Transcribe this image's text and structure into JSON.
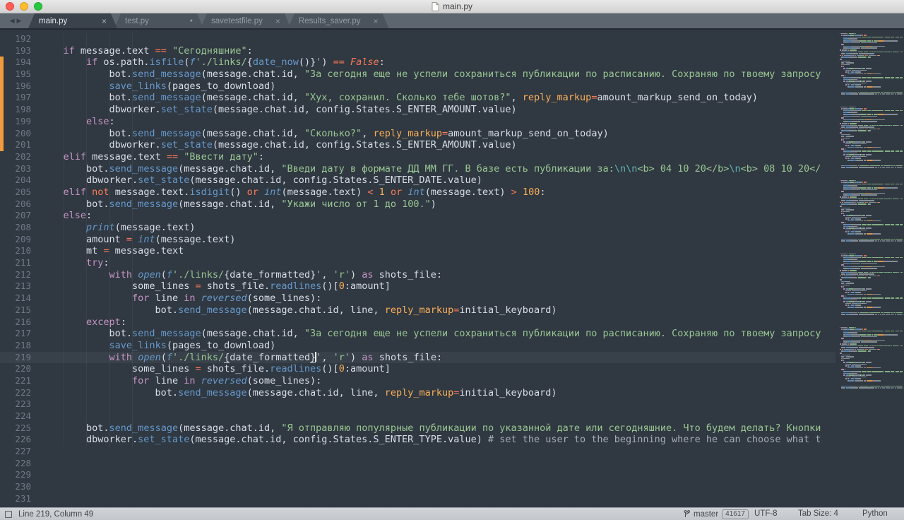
{
  "window": {
    "title": "main.py"
  },
  "tab_bar": {
    "scroll_left": "◀",
    "scroll_right": "▶",
    "close_glyph": "×",
    "dot_glyph": "●",
    "tabs": [
      {
        "label": "main.py",
        "active": true,
        "indicator": "close"
      },
      {
        "label": "test.py",
        "active": false,
        "indicator": "dot"
      },
      {
        "label": "savetestfile.py",
        "active": false,
        "indicator": "close"
      },
      {
        "label": "Results_saver.py",
        "active": false,
        "indicator": "close"
      }
    ]
  },
  "status": {
    "position": "Line 219, Column 49",
    "branch": "master",
    "commits_badge": "41617",
    "encoding": "UTF-8",
    "tab_size": "Tab Size: 4",
    "syntax": "Python"
  },
  "colors": {
    "editor_bg": "#303841",
    "default_fg": "#d8dee9",
    "keyword_purple": "#c695c6",
    "operator_red": "#f97b58",
    "function_blue": "#6699cc",
    "string_green": "#99c794",
    "escape_teal": "#5fb4b4",
    "number_orange": "#f9ae58",
    "comment_gray": "#a6acb9",
    "gutter_fg": "#6e7a87",
    "git_gutter_modified": "#f09b3d",
    "tab_strip_bg": "#5d656e",
    "active_tab_bg": "#3a424c",
    "status_bg": "#c9cdd1",
    "traffic_red": "#ff5f57",
    "traffic_yellow": "#febc2e",
    "traffic_green": "#28c840"
  },
  "editor": {
    "first_line": 192,
    "active_line": 219,
    "git_gutter": {
      "type": "modified",
      "from_line": 194,
      "to_line": 201
    },
    "lines": [
      {
        "n": 192,
        "t": []
      },
      {
        "n": 193,
        "t": [
          [
            "p",
            "    "
          ],
          [
            "k",
            "if"
          ],
          [
            "p",
            " message.text "
          ],
          [
            "o",
            "=="
          ],
          [
            "p",
            " "
          ],
          [
            "s",
            "\"Сегодняшние\""
          ],
          [
            "p",
            ":"
          ]
        ]
      },
      {
        "n": 194,
        "t": [
          [
            "p",
            "        "
          ],
          [
            "k",
            "if"
          ],
          [
            "p",
            " os.path."
          ],
          [
            "f",
            "isfile"
          ],
          [
            "p",
            "("
          ],
          [
            "bi",
            "f"
          ],
          [
            "s",
            "'./links/"
          ],
          [
            "p",
            "{"
          ],
          [
            "f",
            "date_now"
          ],
          [
            "p",
            "()}"
          ],
          [
            "s",
            "'"
          ],
          [
            "p",
            ") "
          ],
          [
            "o",
            "=="
          ],
          [
            "p",
            " "
          ],
          [
            "ci",
            "False"
          ],
          [
            "p",
            ":"
          ]
        ]
      },
      {
        "n": 195,
        "t": [
          [
            "p",
            "            bot."
          ],
          [
            "f",
            "send_message"
          ],
          [
            "p",
            "(message.chat.id, "
          ],
          [
            "s",
            "\"За сегодня еще не успели сохраниться публикации по расписанию. Сохраняю по твоему запросу"
          ]
        ]
      },
      {
        "n": 196,
        "t": [
          [
            "p",
            "            "
          ],
          [
            "f",
            "save_links"
          ],
          [
            "p",
            "(pages_to_download)"
          ]
        ]
      },
      {
        "n": 197,
        "t": [
          [
            "p",
            "            bot."
          ],
          [
            "f",
            "send_message"
          ],
          [
            "p",
            "(message.chat.id, "
          ],
          [
            "s",
            "\"Хух, сохранил. Сколько тебе шотов?\""
          ],
          [
            "p",
            ", "
          ],
          [
            "a",
            "reply_markup"
          ],
          [
            "o",
            "="
          ],
          [
            "p",
            "amount_markup_send_on_today)"
          ]
        ]
      },
      {
        "n": 198,
        "t": [
          [
            "p",
            "            dbworker."
          ],
          [
            "f",
            "set_state"
          ],
          [
            "p",
            "(message.chat.id, config.States.S_ENTER_AMOUNT.value)"
          ]
        ]
      },
      {
        "n": 199,
        "t": [
          [
            "p",
            "        "
          ],
          [
            "k",
            "else"
          ],
          [
            "p",
            ":"
          ]
        ]
      },
      {
        "n": 200,
        "t": [
          [
            "p",
            "            bot."
          ],
          [
            "f",
            "send_message"
          ],
          [
            "p",
            "(message.chat.id, "
          ],
          [
            "s",
            "\"Сколько?\""
          ],
          [
            "p",
            ", "
          ],
          [
            "a",
            "reply_markup"
          ],
          [
            "o",
            "="
          ],
          [
            "p",
            "amount_markup_send_on_today)"
          ]
        ]
      },
      {
        "n": 201,
        "t": [
          [
            "p",
            "            dbworker."
          ],
          [
            "f",
            "set_state"
          ],
          [
            "p",
            "(message.chat.id, config.States.S_ENTER_AMOUNT.value)"
          ]
        ]
      },
      {
        "n": 202,
        "t": [
          [
            "p",
            "    "
          ],
          [
            "k",
            "elif"
          ],
          [
            "p",
            " message.text "
          ],
          [
            "o",
            "=="
          ],
          [
            "p",
            " "
          ],
          [
            "s",
            "\"Ввести дату\""
          ],
          [
            "p",
            ":"
          ]
        ]
      },
      {
        "n": 203,
        "t": [
          [
            "p",
            "        bot."
          ],
          [
            "f",
            "send_message"
          ],
          [
            "p",
            "(message.chat.id, "
          ],
          [
            "s",
            "\"Введи дату в формате ДД ММ ГГ. В базе есть публикации за:"
          ],
          [
            "e",
            "\\n\\n"
          ],
          [
            "s",
            "<b> 04 10 20</b>"
          ],
          [
            "e",
            "\\n"
          ],
          [
            "s",
            "<b> 08 10 20</"
          ]
        ]
      },
      {
        "n": 204,
        "t": [
          [
            "p",
            "        dbworker."
          ],
          [
            "f",
            "set_state"
          ],
          [
            "p",
            "(message.chat.id, config.States.S_ENTER_DATE.value)"
          ]
        ]
      },
      {
        "n": 205,
        "t": [
          [
            "p",
            "    "
          ],
          [
            "k",
            "elif"
          ],
          [
            "p",
            " "
          ],
          [
            "o",
            "not"
          ],
          [
            "p",
            " message.text."
          ],
          [
            "f",
            "isdigit"
          ],
          [
            "p",
            "() "
          ],
          [
            "o",
            "or"
          ],
          [
            "p",
            " "
          ],
          [
            "bi",
            "int"
          ],
          [
            "p",
            "(message.text) "
          ],
          [
            "o",
            "<"
          ],
          [
            "p",
            " "
          ],
          [
            "n",
            "1"
          ],
          [
            "p",
            " "
          ],
          [
            "o",
            "or"
          ],
          [
            "p",
            " "
          ],
          [
            "bi",
            "int"
          ],
          [
            "p",
            "(message.text) "
          ],
          [
            "o",
            ">"
          ],
          [
            "p",
            " "
          ],
          [
            "n",
            "100"
          ],
          [
            "p",
            ":"
          ]
        ]
      },
      {
        "n": 206,
        "t": [
          [
            "p",
            "        bot."
          ],
          [
            "f",
            "send_message"
          ],
          [
            "p",
            "(message.chat.id, "
          ],
          [
            "s",
            "\"Укажи число от 1 до 100.\""
          ],
          [
            "p",
            ")"
          ]
        ]
      },
      {
        "n": 207,
        "t": [
          [
            "p",
            "    "
          ],
          [
            "k",
            "else"
          ],
          [
            "p",
            ":"
          ]
        ]
      },
      {
        "n": 208,
        "t": [
          [
            "p",
            "        "
          ],
          [
            "bi",
            "print"
          ],
          [
            "p",
            "(message.text)"
          ]
        ]
      },
      {
        "n": 209,
        "t": [
          [
            "p",
            "        amount "
          ],
          [
            "o",
            "="
          ],
          [
            "p",
            " "
          ],
          [
            "bi",
            "int"
          ],
          [
            "p",
            "(message.text)"
          ]
        ]
      },
      {
        "n": 210,
        "t": [
          [
            "p",
            "        mt "
          ],
          [
            "o",
            "="
          ],
          [
            "p",
            " message.text"
          ]
        ]
      },
      {
        "n": 211,
        "t": [
          [
            "p",
            "        "
          ],
          [
            "k",
            "try"
          ],
          [
            "p",
            ":"
          ]
        ]
      },
      {
        "n": 212,
        "t": [
          [
            "p",
            "            "
          ],
          [
            "k",
            "with"
          ],
          [
            "p",
            " "
          ],
          [
            "bi",
            "open"
          ],
          [
            "p",
            "("
          ],
          [
            "bi",
            "f"
          ],
          [
            "s",
            "'./links/"
          ],
          [
            "p",
            "{date_formatted}"
          ],
          [
            "s",
            "'"
          ],
          [
            "p",
            ", "
          ],
          [
            "s",
            "'r'"
          ],
          [
            "p",
            ") "
          ],
          [
            "k",
            "as"
          ],
          [
            "p",
            " shots_file:"
          ]
        ]
      },
      {
        "n": 213,
        "t": [
          [
            "p",
            "                some_lines "
          ],
          [
            "o",
            "="
          ],
          [
            "p",
            " shots_file."
          ],
          [
            "f",
            "readlines"
          ],
          [
            "p",
            "()["
          ],
          [
            "n",
            "0"
          ],
          [
            "p",
            ":amount]"
          ]
        ]
      },
      {
        "n": 214,
        "t": [
          [
            "p",
            "                "
          ],
          [
            "k",
            "for"
          ],
          [
            "p",
            " line "
          ],
          [
            "k",
            "in"
          ],
          [
            "p",
            " "
          ],
          [
            "bi",
            "reversed"
          ],
          [
            "p",
            "(some_lines):"
          ]
        ]
      },
      {
        "n": 215,
        "t": [
          [
            "p",
            "                    bot."
          ],
          [
            "f",
            "send_message"
          ],
          [
            "p",
            "(message.chat.id, line, "
          ],
          [
            "a",
            "reply_markup"
          ],
          [
            "o",
            "="
          ],
          [
            "p",
            "initial_keyboard)"
          ]
        ]
      },
      {
        "n": 216,
        "t": [
          [
            "p",
            "        "
          ],
          [
            "k",
            "except"
          ],
          [
            "p",
            ":"
          ]
        ]
      },
      {
        "n": 217,
        "t": [
          [
            "p",
            "            bot."
          ],
          [
            "f",
            "send_message"
          ],
          [
            "p",
            "(message.chat.id, "
          ],
          [
            "s",
            "\"За сегодня еще не успели сохраниться публикации по расписанию. Сохраняю по твоему запросу"
          ]
        ]
      },
      {
        "n": 218,
        "t": [
          [
            "p",
            "            "
          ],
          [
            "f",
            "save_links"
          ],
          [
            "p",
            "(pages_to_download)"
          ]
        ]
      },
      {
        "n": 219,
        "t": [
          [
            "p",
            "            "
          ],
          [
            "k",
            "with"
          ],
          [
            "p",
            " "
          ],
          [
            "bi",
            "open"
          ],
          [
            "p",
            "("
          ],
          [
            "bi",
            "f"
          ],
          [
            "s",
            "'./links/"
          ],
          [
            "bm",
            "{"
          ],
          [
            "p",
            "date_formatted"
          ],
          [
            "bm",
            "}"
          ],
          [
            "caret",
            ""
          ],
          [
            "s",
            "'"
          ],
          [
            "p",
            ", "
          ],
          [
            "s",
            "'r'"
          ],
          [
            "p",
            ") "
          ],
          [
            "k",
            "as"
          ],
          [
            "p",
            " shots_file:"
          ]
        ]
      },
      {
        "n": 220,
        "t": [
          [
            "p",
            "                some_lines "
          ],
          [
            "o",
            "="
          ],
          [
            "p",
            " shots_file."
          ],
          [
            "f",
            "readlines"
          ],
          [
            "p",
            "()["
          ],
          [
            "n",
            "0"
          ],
          [
            "p",
            ":amount]"
          ]
        ]
      },
      {
        "n": 221,
        "t": [
          [
            "p",
            "                "
          ],
          [
            "k",
            "for"
          ],
          [
            "p",
            " line "
          ],
          [
            "k",
            "in"
          ],
          [
            "p",
            " "
          ],
          [
            "bi",
            "reversed"
          ],
          [
            "p",
            "(some_lines):"
          ]
        ]
      },
      {
        "n": 222,
        "t": [
          [
            "p",
            "                    bot."
          ],
          [
            "f",
            "send_message"
          ],
          [
            "p",
            "(message.chat.id, line, "
          ],
          [
            "a",
            "reply_markup"
          ],
          [
            "o",
            "="
          ],
          [
            "p",
            "initial_keyboard)"
          ]
        ]
      },
      {
        "n": 223,
        "t": []
      },
      {
        "n": 224,
        "t": []
      },
      {
        "n": 225,
        "t": [
          [
            "p",
            "        bot."
          ],
          [
            "f",
            "send_message"
          ],
          [
            "p",
            "(message.chat.id, "
          ],
          [
            "s",
            "\"Я отправляю популярные публикации по указанной дате или сегодняшние. Что будем делать? Кнопки"
          ]
        ]
      },
      {
        "n": 226,
        "t": [
          [
            "p",
            "        dbworker."
          ],
          [
            "f",
            "set_state"
          ],
          [
            "p",
            "(message.chat.id, config.States.S_ENTER_TYPE.value) "
          ],
          [
            "c",
            "# set the user to the beginning where he can choose what t"
          ]
        ]
      },
      {
        "n": 227,
        "t": []
      },
      {
        "n": 228,
        "t": []
      },
      {
        "n": 229,
        "t": []
      },
      {
        "n": 230,
        "t": []
      },
      {
        "n": 231,
        "t": []
      }
    ]
  }
}
